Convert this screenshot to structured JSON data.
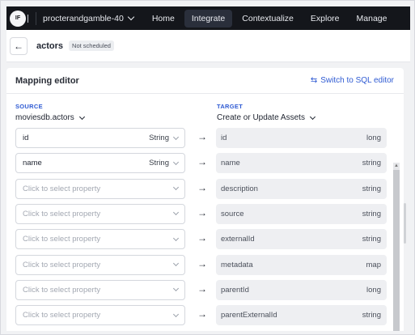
{
  "nav": {
    "logo_text": "IF",
    "project": "procterandgamble-40",
    "items": [
      {
        "label": "Home",
        "active": false
      },
      {
        "label": "Integrate",
        "active": true
      },
      {
        "label": "Contextualize",
        "active": false
      },
      {
        "label": "Explore",
        "active": false
      },
      {
        "label": "Manage",
        "active": false
      }
    ]
  },
  "header": {
    "title": "actors",
    "badge": "Not scheduled"
  },
  "editor": {
    "title": "Mapping editor",
    "switch_label": "Switch to SQL editor",
    "source_heading": "SOURCE",
    "source_value": "moviesdb.actors",
    "target_heading": "TARGET",
    "target_value": "Create or Update Assets"
  },
  "mappings": [
    {
      "source": "id",
      "source_type": "String",
      "empty": false,
      "target": "id",
      "target_type": "long"
    },
    {
      "source": "name",
      "source_type": "String",
      "empty": false,
      "target": "name",
      "target_type": "string"
    },
    {
      "source": "Click to select property",
      "source_type": "",
      "empty": true,
      "target": "description",
      "target_type": "string"
    },
    {
      "source": "Click to select property",
      "source_type": "",
      "empty": true,
      "target": "source",
      "target_type": "string"
    },
    {
      "source": "Click to select property",
      "source_type": "",
      "empty": true,
      "target": "externalId",
      "target_type": "string"
    },
    {
      "source": "Click to select property",
      "source_type": "",
      "empty": true,
      "target": "metadata",
      "target_type": "map"
    },
    {
      "source": "Click to select property",
      "source_type": "",
      "empty": true,
      "target": "parentId",
      "target_type": "long"
    },
    {
      "source": "Click to select property",
      "source_type": "",
      "empty": true,
      "target": "parentExternalId",
      "target_type": "string"
    }
  ],
  "colors": {
    "accent": "#2f5bd3",
    "nav_bg": "#14161b"
  }
}
